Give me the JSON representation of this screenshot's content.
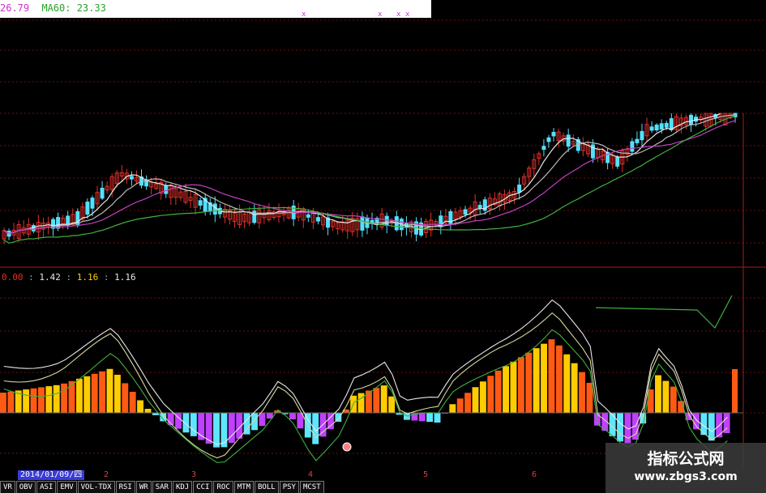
{
  "header": {
    "ma_partial": "26.79",
    "ma60_label": "MA60: 23.33",
    "ma60_color": "#2aa12a",
    "ma_partial_color": "#cc33cc"
  },
  "markers": [
    "x",
    "x",
    "x",
    "x"
  ],
  "indicator_legend": {
    "v1": "0.00",
    "v2": "1.42",
    "v3": "1.16",
    "v4": "1.16"
  },
  "date_axis": {
    "cursor_date": "2014/01/09/四",
    "ticks": [
      "2",
      "3",
      "4",
      "5",
      "6"
    ]
  },
  "tabs": [
    "VR",
    "OBV",
    "ASI",
    "EMV",
    "VOL-TDX",
    "RSI",
    "WR",
    "SAR",
    "KDJ",
    "CCI",
    "ROC",
    "MTM",
    "BOLL",
    "PSY",
    "MCST"
  ],
  "watermark": {
    "title": "指标公式网",
    "url": "www.zbgs3.com"
  },
  "colors": {
    "up": "#e0302a",
    "down": "#54e0ff",
    "pos_bar_a": "#ff5a14",
    "pos_bar_b": "#ffcc00",
    "neg_bar_a": "#5fe6ff",
    "neg_bar_b": "#c040ff",
    "ma_white": "#e8e8e8",
    "ma_purple": "#c040c0",
    "ma_green": "#40b040",
    "grid": "#6b1010"
  }
}
